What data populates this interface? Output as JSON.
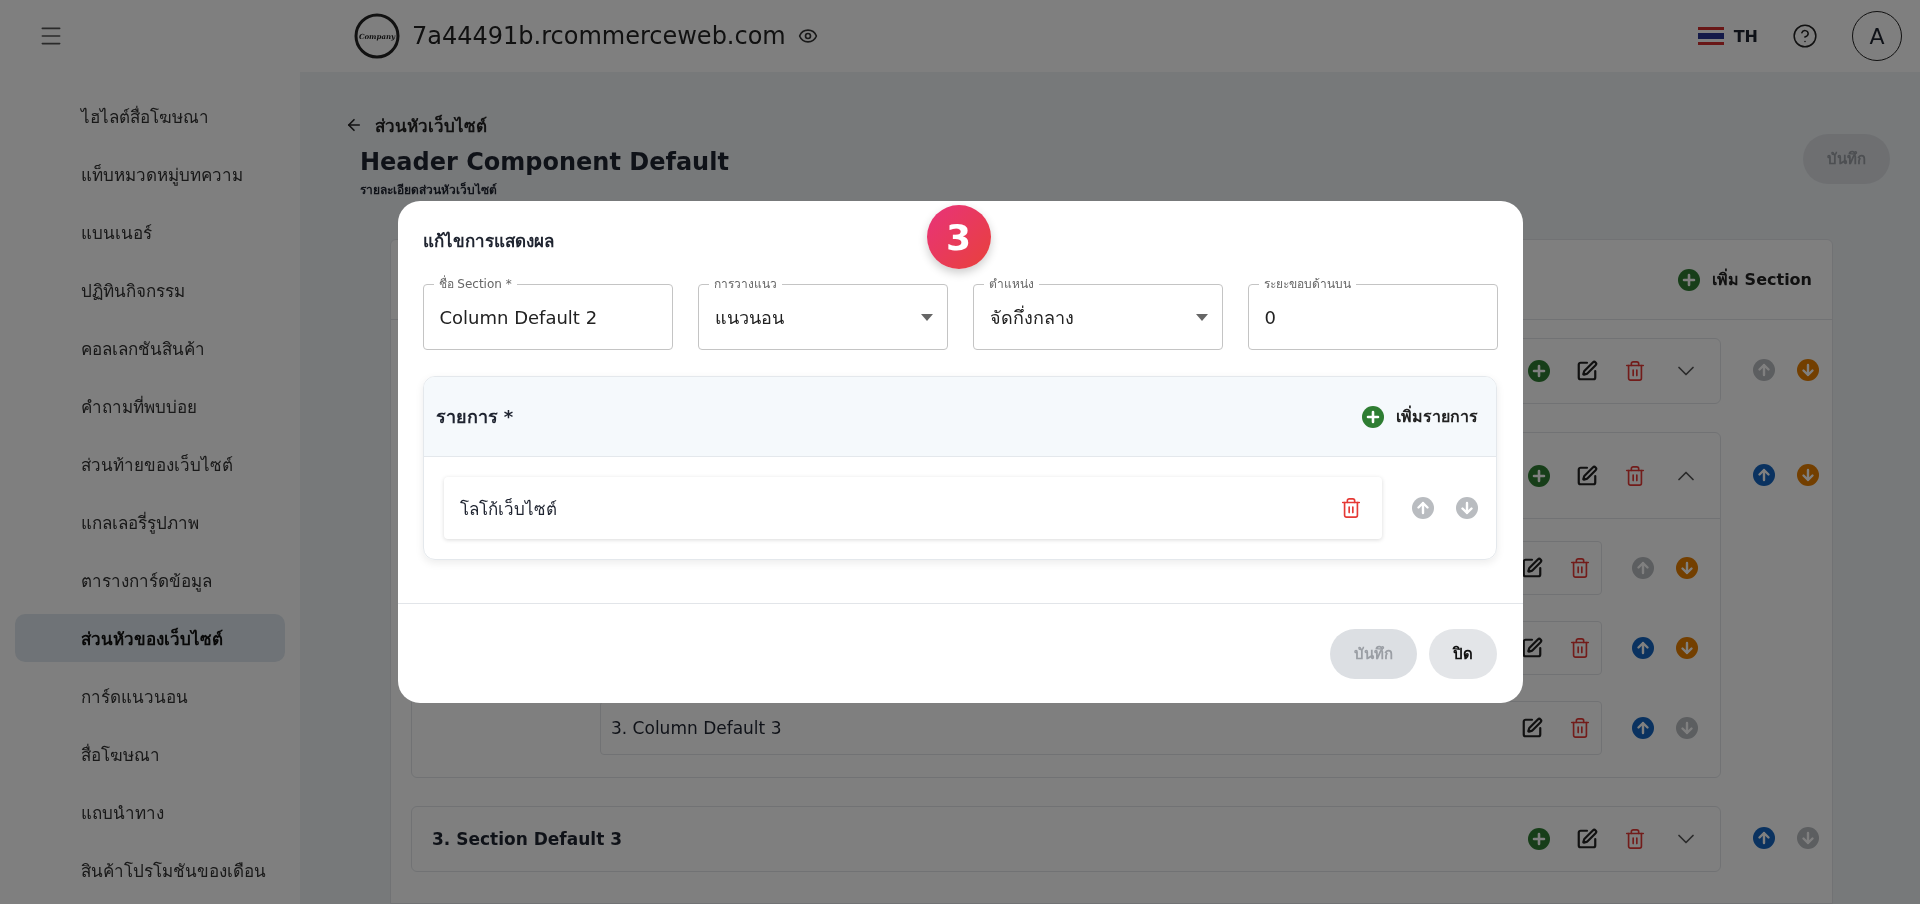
{
  "topbar": {
    "logo_text": "Company",
    "domain": "7a44491b.rcommerceweb.com",
    "language": "TH",
    "avatar": "A"
  },
  "sidebar": {
    "items": [
      {
        "label": "ไฮไลต์สื่อโฆษณา",
        "selected": false
      },
      {
        "label": "แท็บหมวดหมู่บทความ",
        "selected": false
      },
      {
        "label": "แบนเนอร์",
        "selected": false
      },
      {
        "label": "ปฏิทินกิจกรรม",
        "selected": false
      },
      {
        "label": "คอลเลกชันสินค้า",
        "selected": false
      },
      {
        "label": "คำถามที่พบบ่อย",
        "selected": false
      },
      {
        "label": "ส่วนท้ายของเว็บไซต์",
        "selected": false
      },
      {
        "label": "แกลเลอรี่รูปภาพ",
        "selected": false
      },
      {
        "label": "ตารางการ์ดข้อมูล",
        "selected": false
      },
      {
        "label": "ส่วนหัวของเว็บไซต์",
        "selected": true
      },
      {
        "label": "การ์ดแนวนอน",
        "selected": false
      },
      {
        "label": "สื่อโฆษณา",
        "selected": false
      },
      {
        "label": "แถบนำทาง",
        "selected": false
      },
      {
        "label": "สินค้าโปรโมชันของเดือน",
        "selected": false
      }
    ]
  },
  "page": {
    "back_label": "ส่วนหัวเว็บไซต์",
    "title": "Header Component Default",
    "subtitle": "รายละเอียดส่วนหัวเว็บไซต์",
    "save_button": {
      "label": "บันทึก",
      "disabled": true
    },
    "add_section": "เพิ่ม Section",
    "sections": [
      {
        "expanded": false,
        "up_enabled": false,
        "down_enabled": true
      },
      {
        "expanded": true,
        "up_enabled": true,
        "down_enabled": true,
        "columns": [
          {
            "up_enabled": false,
            "down_enabled": true
          },
          {
            "up_enabled": true,
            "down_enabled": true
          },
          {
            "title": "3. Column Default 3",
            "up_enabled": true,
            "down_enabled": false
          }
        ]
      },
      {
        "title": "3. Section Default 3",
        "expanded": false,
        "up_enabled": true,
        "down_enabled": false
      }
    ]
  },
  "dialog": {
    "title": "แก้ไขการแสดงผล",
    "step": "3",
    "fields": [
      {
        "kind": "text",
        "label": "ชื่อ Section *",
        "value": "Column Default 2"
      },
      {
        "kind": "select",
        "label": "การวางแนว",
        "value": "แนวนอน"
      },
      {
        "kind": "select",
        "label": "ตำแหน่ง",
        "value": "จัดกึ่งกลาง"
      },
      {
        "kind": "text",
        "label": "ระยะขอบด้านบน",
        "value": "0"
      }
    ],
    "items_header": "รายการ *",
    "add_item": "เพิ่มรายการ",
    "items": [
      {
        "label": "โลโก้เว็บไซต์",
        "up_enabled": false,
        "down_enabled": false
      }
    ],
    "buttons": [
      {
        "label": "บันทึก",
        "disabled": true
      },
      {
        "label": "ปิด",
        "disabled": false
      }
    ]
  }
}
